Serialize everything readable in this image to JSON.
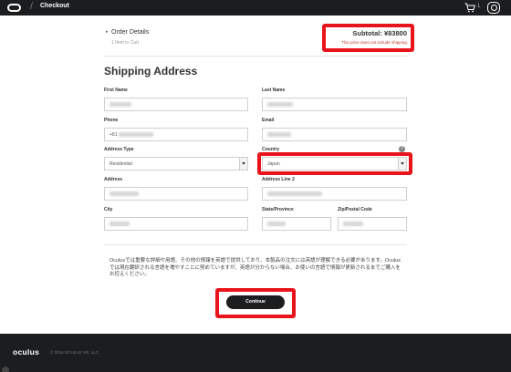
{
  "header": {
    "title": "Checkout",
    "cart_count": "1"
  },
  "order": {
    "title": "Order Details",
    "items_in_cart": "1 Item in Cart",
    "subtotal": "Subtotal: ¥83800",
    "subtotal_note": "This price does not include shipping."
  },
  "shipping": {
    "title": "Shipping Address",
    "fields": {
      "first_name": {
        "label": "First Name",
        "value": ""
      },
      "last_name": {
        "label": "Last Name",
        "value": ""
      },
      "phone": {
        "label": "Phone",
        "value": "+81"
      },
      "email": {
        "label": "Email",
        "value": ""
      },
      "address_type": {
        "label": "Address Type",
        "value": "Residential"
      },
      "country": {
        "label": "Country",
        "value": "Japan"
      },
      "address": {
        "label": "Address",
        "value": ""
      },
      "address_line_2": {
        "label": "Address Line 2",
        "value": ""
      },
      "city": {
        "label": "City",
        "value": ""
      },
      "state": {
        "label": "State/Province",
        "value": ""
      },
      "postal_code": {
        "label": "Zip/Postal Code",
        "value": ""
      }
    }
  },
  "notice": "Oculusでは重要な詳細や用語、その他の情報を英語で提供しており、本製品の注文には英語が理解できる必要があります。Oculusでは現在翻訳される言語を増やすことに努めていますが、英語が分からない場合、お使いの言語で情報が更新されるまでご購入をお控えください。",
  "continue_label": "Continue",
  "footer": {
    "logo": "oculus",
    "copyright": "© 2016 OCULUS VR, LLC"
  },
  "colors": {
    "highlight": "#e8131b",
    "dark": "#1c1d1f"
  },
  "icons": [
    "oculus-logo-icon",
    "cart-icon",
    "user-icon",
    "info-icon",
    "chevron-down-icon"
  ]
}
